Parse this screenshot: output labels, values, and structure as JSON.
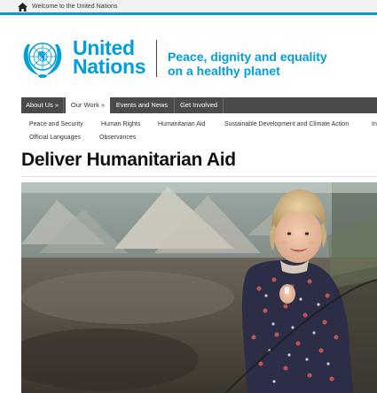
{
  "topbar": {
    "welcome_text": "Welcome to the United Nations",
    "home_icon": "home-icon"
  },
  "brand": {
    "name_line1": "United",
    "name_line2": "Nations",
    "tagline_line1": "Peace, dignity and equality",
    "tagline_line2": "on a healthy planet",
    "accent_color": "#009edb",
    "logo_icon": "un-emblem-icon"
  },
  "nav": {
    "items": [
      {
        "label": "About Us »",
        "active": false
      },
      {
        "label": "Our Work »",
        "active": true
      },
      {
        "label": "Events and News",
        "active": false
      },
      {
        "label": "Get Involved",
        "active": false
      }
    ]
  },
  "subnav": {
    "items": [
      "Peace and Security",
      "Human Rights",
      "Humanitarian Aid",
      "Sustainable Development and Climate Action",
      "In",
      "Official Languages",
      "Observances"
    ]
  },
  "page": {
    "title": "Deliver Humanitarian Aid"
  },
  "hero": {
    "image_icon": "child-in-refugee-camp-photo"
  }
}
